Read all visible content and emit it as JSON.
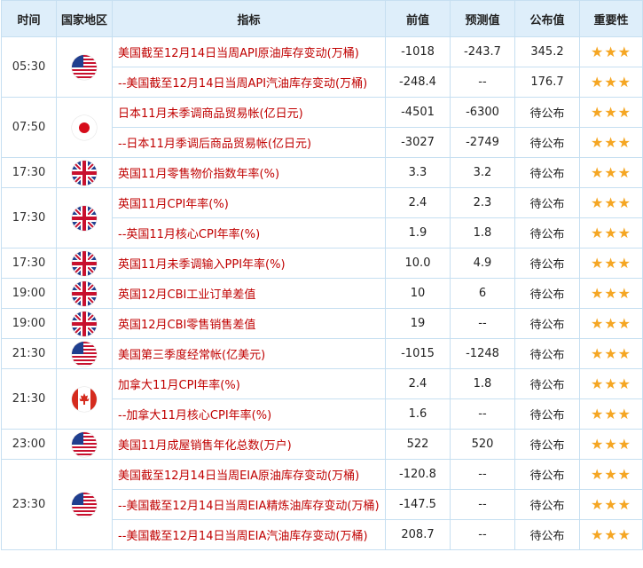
{
  "headers": [
    "时间",
    "国家地区",
    "指标",
    "前值",
    "预测值",
    "公布值",
    "重要性"
  ],
  "groups": [
    {
      "time": "05:30",
      "country": "us",
      "rows": [
        {
          "indicator": "美国截至12月14日当周API原油库存变动(万桶)",
          "prev": "-1018",
          "forecast": "-243.7",
          "actual": "345.2",
          "stars": "★★★"
        },
        {
          "indicator": "--美国截至12月14日当周API汽油库存变动(万桶)",
          "prev": "-248.4",
          "forecast": "--",
          "actual": "176.7",
          "stars": "★★★"
        }
      ]
    },
    {
      "time": "07:50",
      "country": "jp",
      "rows": [
        {
          "indicator": "日本11月未季调商品贸易帐(亿日元)",
          "prev": "-4501",
          "forecast": "-6300",
          "actual": "待公布",
          "stars": "★★★"
        },
        {
          "indicator": "--日本11月季调后商品贸易帐(亿日元)",
          "prev": "-3027",
          "forecast": "-2749",
          "actual": "待公布",
          "stars": "★★★"
        }
      ]
    },
    {
      "time": "17:30",
      "country": "uk",
      "rows": [
        {
          "indicator": "英国11月零售物价指数年率(%)",
          "prev": "3.3",
          "forecast": "3.2",
          "actual": "待公布",
          "stars": "★★★"
        }
      ]
    },
    {
      "time": "17:30",
      "country": "uk",
      "rows": [
        {
          "indicator": "英国11月CPI年率(%)",
          "prev": "2.4",
          "forecast": "2.3",
          "actual": "待公布",
          "stars": "★★★"
        },
        {
          "indicator": "--英国11月核心CPI年率(%)",
          "prev": "1.9",
          "forecast": "1.8",
          "actual": "待公布",
          "stars": "★★★"
        }
      ]
    },
    {
      "time": "17:30",
      "country": "uk",
      "rows": [
        {
          "indicator": "英国11月未季调输入PPI年率(%)",
          "prev": "10.0",
          "forecast": "4.9",
          "actual": "待公布",
          "stars": "★★★"
        }
      ]
    },
    {
      "time": "19:00",
      "country": "uk",
      "rows": [
        {
          "indicator": "英国12月CBI工业订单差值",
          "prev": "10",
          "forecast": "6",
          "actual": "待公布",
          "stars": "★★★"
        }
      ]
    },
    {
      "time": "19:00",
      "country": "uk",
      "rows": [
        {
          "indicator": "英国12月CBI零售销售差值",
          "prev": "19",
          "forecast": "--",
          "actual": "待公布",
          "stars": "★★★"
        }
      ]
    },
    {
      "time": "21:30",
      "country": "us",
      "rows": [
        {
          "indicator": "美国第三季度经常帐(亿美元)",
          "prev": "-1015",
          "forecast": "-1248",
          "actual": "待公布",
          "stars": "★★★"
        }
      ]
    },
    {
      "time": "21:30",
      "country": "ca",
      "rows": [
        {
          "indicator": "加拿大11月CPI年率(%)",
          "prev": "2.4",
          "forecast": "1.8",
          "actual": "待公布",
          "stars": "★★★"
        },
        {
          "indicator": "--加拿大11月核心CPI年率(%)",
          "prev": "1.6",
          "forecast": "--",
          "actual": "待公布",
          "stars": "★★★"
        }
      ]
    },
    {
      "time": "23:00",
      "country": "us",
      "rows": [
        {
          "indicator": "美国11月成屋销售年化总数(万户)",
          "prev": "522",
          "forecast": "520",
          "actual": "待公布",
          "stars": "★★★"
        }
      ]
    },
    {
      "time": "23:30",
      "country": "us",
      "rows": [
        {
          "indicator": "美国截至12月14日当周EIA原油库存变动(万桶)",
          "prev": "-120.8",
          "forecast": "--",
          "actual": "待公布",
          "stars": "★★★"
        },
        {
          "indicator": "--美国截至12月14日当周EIA精炼油库存变动(万桶)",
          "prev": "-147.5",
          "forecast": "--",
          "actual": "待公布",
          "stars": "★★★"
        },
        {
          "indicator": "--美国截至12月14日当周EIA汽油库存变动(万桶)",
          "prev": "208.7",
          "forecast": "--",
          "actual": "待公布",
          "stars": "★★★"
        }
      ]
    }
  ]
}
